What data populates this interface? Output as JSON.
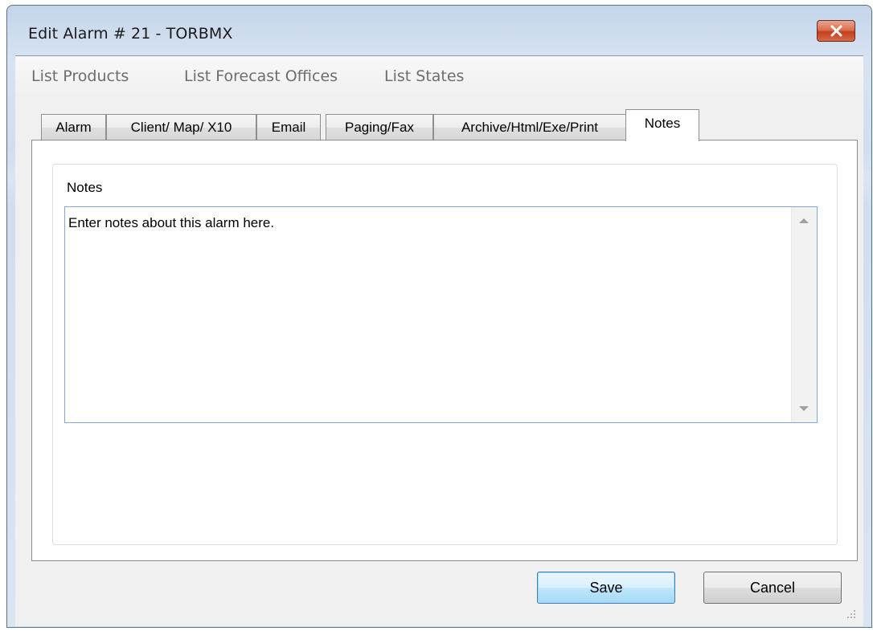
{
  "window": {
    "title": "Edit Alarm # 21 - TORBMX"
  },
  "menubar": {
    "items": [
      {
        "label": "List Products"
      },
      {
        "label": "List Forecast Offices"
      },
      {
        "label": "List States"
      }
    ]
  },
  "tabs": [
    {
      "label": "Alarm",
      "active": false
    },
    {
      "label": "Client/ Map/ X10",
      "active": false
    },
    {
      "label": "Email",
      "active": false
    },
    {
      "label": "Paging/Fax",
      "active": false
    },
    {
      "label": "Archive/Html/Exe/Print",
      "active": false
    },
    {
      "label": "Notes",
      "active": true
    }
  ],
  "notes": {
    "group_label": "Notes",
    "text": "Enter notes about this alarm here."
  },
  "buttons": {
    "save_label": "Save",
    "cancel_label": "Cancel"
  },
  "colors": {
    "title_bar": "#d4e1f0",
    "close_button": "#c4401e",
    "default_button": "#bee6fd",
    "textarea_border": "#7fa8d3"
  }
}
